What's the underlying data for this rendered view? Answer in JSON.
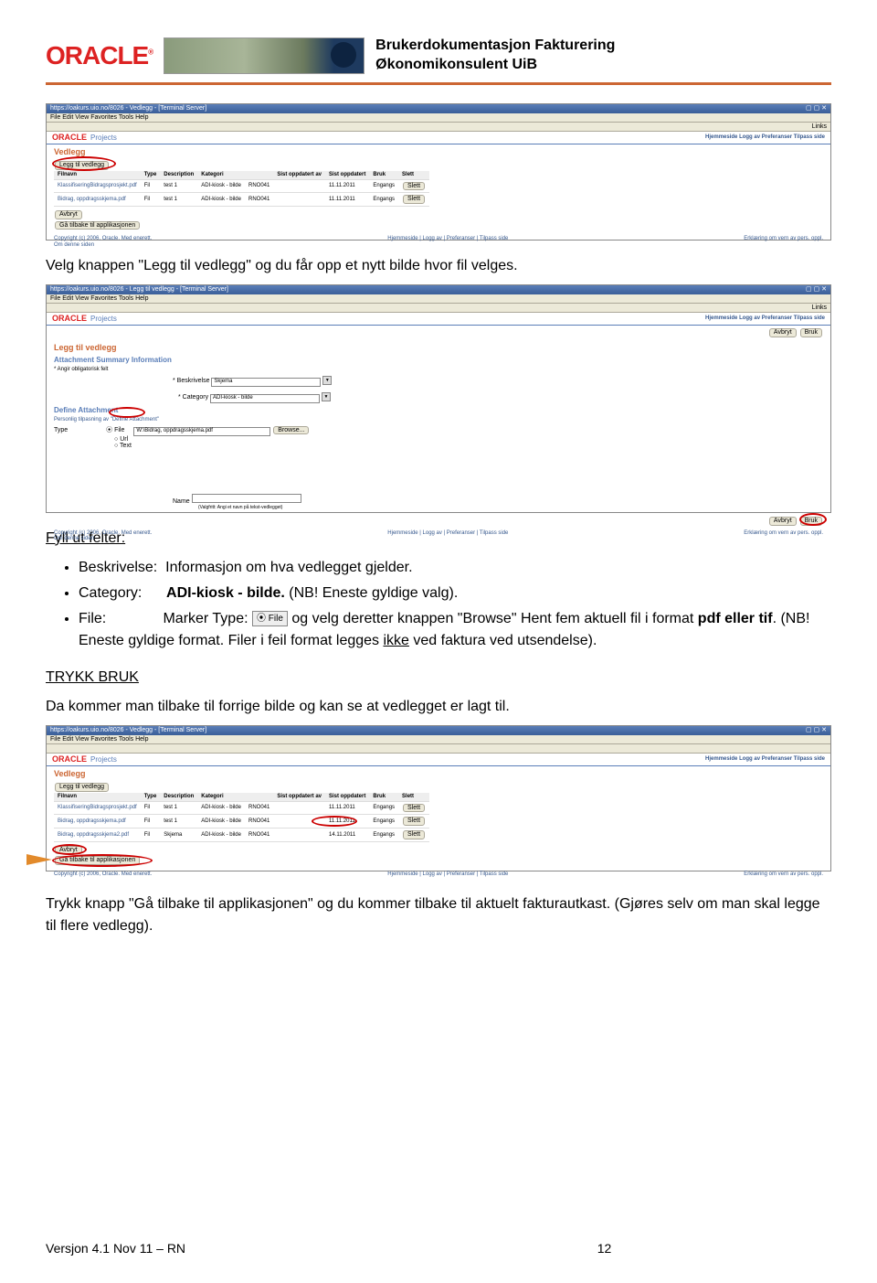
{
  "header": {
    "logo": "ORACLE",
    "tm": "®",
    "title_line1": "Brukerdokumentasjon Fakturering",
    "title_line2": "Økonomikonsulent UiB"
  },
  "ss1": {
    "titlebar": "https://oakurs.uio.no/8026 - Vedlegg - [Terminal Server]",
    "menubar": "File  Edit  View  Favorites  Tools  Help",
    "toolbar": "Links",
    "logo": "ORACLE",
    "projects": "Projects",
    "nav": "Hjemmeside  Logg av  Preferanser  Tilpass side",
    "h1": "Vedlegg",
    "btn_add": "Legg til vedlegg",
    "table": {
      "headers": [
        "Filnavn",
        "Type",
        "Description",
        "Kategori",
        "",
        "Sist oppdatert av",
        "Sist oppdatert",
        "Bruk",
        "Slett"
      ],
      "rows": [
        [
          "KlassifiseringBidragsprosjekt.pdf",
          "Fil",
          "test 1",
          "ADI-kiosk - bilde",
          "RNO041",
          "",
          "11.11.2011",
          "Engangs",
          "Slett"
        ],
        [
          "Bidrag, oppdragsskjema.pdf",
          "Fil",
          "test 1",
          "ADI-kiosk - bilde",
          "RNO041",
          "",
          "11.11.2011",
          "Engangs",
          "Slett"
        ]
      ]
    },
    "btn_cancel": "Avbryt",
    "btn_back": "Gå tilbake til applikasjonen",
    "footer_links": "Hjemmeside | Logg av | Preferanser | Tilpass side",
    "copyright": "Copyright (c) 2006, Oracle. Med enerett.",
    "priv": "Om denne siden",
    "erk": "Erklæring om vern av pers. oppl."
  },
  "para1": "Velg knappen \"Legg til vedlegg\" og du får opp et nytt bilde hvor fil velges.",
  "ss2": {
    "titlebar": "https://oakurs.uio.no/8026 - Legg til vedlegg - [Terminal Server]",
    "menubar": "File  Edit  View  Favorites  Tools  Help",
    "toolbar": "Links",
    "logo": "ORACLE",
    "projects": "Projects",
    "nav": "Hjemmeside  Logg av  Preferanser  Tilpass side",
    "btn_right1": "Avbryt",
    "btn_right2": "Bruk",
    "h1": "Legg til vedlegg",
    "h2a": "Attachment Summary Information",
    "req": "* Angir obligatorisk felt",
    "lbl_beskriv": "* Beskrivelse",
    "val_beskriv": "Skjema",
    "lbl_cat": "* Category",
    "val_cat": "ADI-kiosk - bilde",
    "h2b": "Define Attachment",
    "sub": "Personlig tilpasning av \"Define Attachment\"",
    "lbl_type": "Type",
    "rb_file": "File",
    "rb_url": "Url",
    "rb_text": "Text",
    "val_path": "W:\\Bidrag, oppdragsskjema.pdf",
    "btn_browse": "Browse...",
    "lbl_name": "Name",
    "hint": "(Valgfritt: Angi et navn på tekst-vedlegget)",
    "footer_links": "Hjemmeside | Logg av | Preferanser | Tilpass side",
    "copyright": "Copyright (c) 2006, Oracle. Med enerett.",
    "priv": "Om denne siden",
    "erk": "Erklæring om vern av pers. oppl."
  },
  "para_fyll": "Fyll ut felter:",
  "bullets": {
    "b1_label": "Beskrivelse:",
    "b1_text": "Informasjon om hva vedlegget gjelder.",
    "b2_label": "Category:",
    "b2_text_a": "ADI-kiosk - bilde.",
    "b2_text_b": " (NB! Eneste gyldige valg).",
    "b3_label": "File:",
    "b3_text_a": "Marker Type: ",
    "b3_radio": "File",
    "b3_text_b": " og velg deretter knappen \"Browse\" Hent fem aktuell fil i format ",
    "b3_bold": "pdf eller tif",
    "b3_text_c": ". (NB! Eneste gyldige format. Filer i feil format legges ",
    "b3_under": "ikke",
    "b3_text_d": " ved faktura ved utsendelse)."
  },
  "para_bruk": "TRYKK BRUK",
  "para2": "Da kommer man tilbake til forrige bilde og kan se at vedlegget er lagt til.",
  "ss3": {
    "titlebar": "https://oakurs.uio.no/8026 - Vedlegg - [Terminal Server]",
    "menubar": "File  Edit  View  Favorites  Tools  Help",
    "logo": "ORACLE",
    "projects": "Projects",
    "nav": "Hjemmeside  Logg av  Preferanser  Tilpass side",
    "h1": "Vedlegg",
    "btn_add": "Legg til vedlegg",
    "table": {
      "headers": [
        "Filnavn",
        "Type",
        "Description",
        "Kategori",
        "",
        "Sist oppdatert av",
        "Sist oppdatert",
        "Bruk",
        "Slett"
      ],
      "rows": [
        [
          "KlassifiseringBidragsprosjekt.pdf",
          "Fil",
          "test 1",
          "ADI-kiosk - bilde",
          "RNO041",
          "",
          "11.11.2011",
          "Engangs",
          "Slett"
        ],
        [
          "Bidrag, oppdragsskjema.pdf",
          "Fil",
          "test 1",
          "ADI-kiosk - bilde",
          "RNO041",
          "",
          "11.11.2011",
          "Engangs",
          "Slett"
        ],
        [
          "Bidrag, oppdragsskjema2.pdf",
          "Fil",
          "Skjema",
          "ADI-kiosk - bilde",
          "RNO041",
          "",
          "14.11.2011",
          "Engangs",
          "Slett"
        ]
      ]
    },
    "btn_cancel": "Avbryt",
    "btn_back": "Gå tilbake til applikasjonen",
    "footer_links": "Hjemmeside | Logg av | Preferanser | Tilpass side",
    "copyright": "Copyright (c) 2006, Oracle. Med enerett.",
    "erk": "Erklæring om vern av pers. oppl."
  },
  "para3": "Trykk knapp \"Gå tilbake til applikasjonen\" og du kommer tilbake til aktuelt fakturautkast. (Gjøres selv om man skal legge til flere vedlegg).",
  "footer": {
    "version": "Versjon 4.1 Nov 11 – RN",
    "page": "12"
  }
}
